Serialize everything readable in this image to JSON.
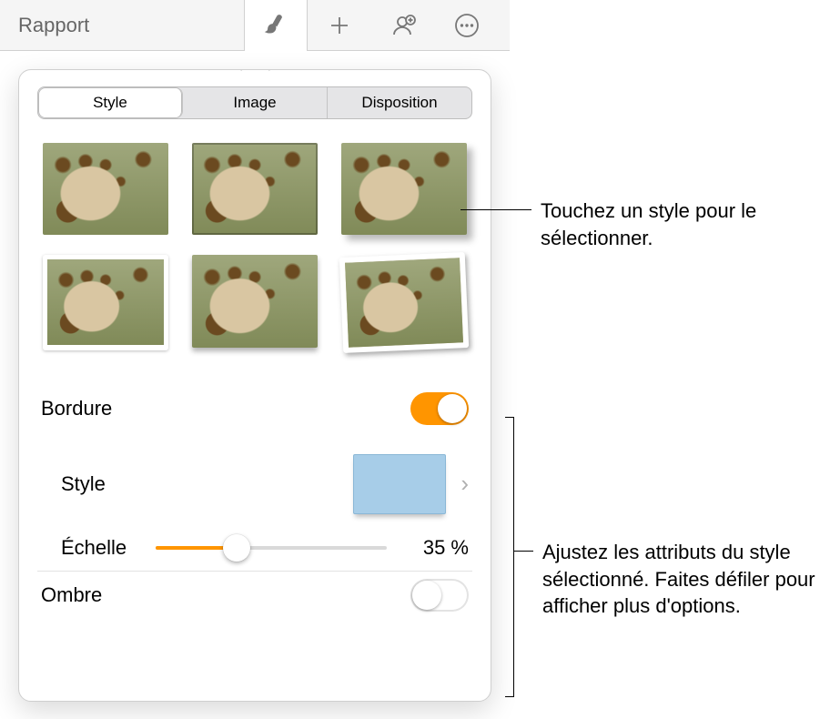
{
  "toolbar": {
    "title": "Rapport"
  },
  "tabs": {
    "style": "Style",
    "image": "Image",
    "disposition": "Disposition"
  },
  "rows": {
    "bordure": "Bordure",
    "style": "Style",
    "echelle": "Échelle",
    "ombre": "Ombre"
  },
  "values": {
    "echelle_pct_text": "35 %",
    "echelle_pct": 35
  },
  "callouts": {
    "top": "Touchez un style pour le sélectionner.",
    "bottom": "Ajustez les attributs du style sélectionné. Faites défiler pour afficher plus d'options."
  },
  "colors": {
    "accent": "#ff9500",
    "swatch": "#a7cde8"
  }
}
